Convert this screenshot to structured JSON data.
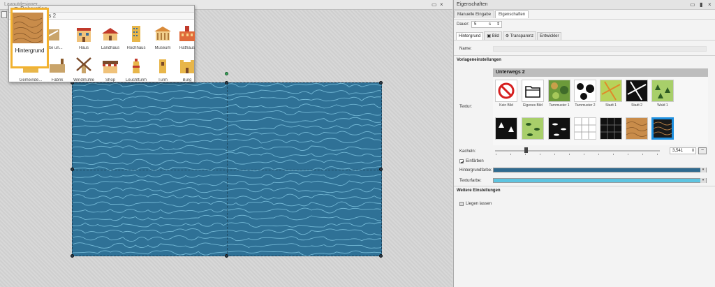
{
  "canvas": {
    "window_title": "Layoutdesigner",
    "colors": {
      "image_bg": "#2f7196",
      "line": "#7fc4e0"
    }
  },
  "palette": {
    "section": "Dekoration",
    "subsection": "Unterwegs 2",
    "selected_label": "Hintergrund",
    "row1": [
      "Hintergrund",
      "Straße un...",
      "Haus",
      "Landhaus",
      "Hochhaus",
      "Museum",
      "Rathaus"
    ],
    "row2": [
      "Gemeinde...",
      "Fabrik",
      "Windmühle",
      "Shop",
      "Leuchtturm",
      "Turm",
      "Burg"
    ]
  },
  "panel": {
    "title": "Eigenschaften",
    "tabs": [
      "Manuelle Eingabe",
      "Eigenschaften"
    ],
    "dauer_label": "Dauer:",
    "dauer_value": "5",
    "dauer_unit": "s",
    "subtabs": [
      "Hintergrund",
      "Bild",
      "Transparenz",
      "Entwickler"
    ],
    "name_label": "Name:",
    "vorlagen_head": "Vorlageneinstellungen",
    "textur_label": "Textur:",
    "texture_group": "Unterwegs 2",
    "textures_row1": [
      {
        "label": "Kein Bild",
        "icon": "no-image-icon"
      },
      {
        "label": "Eigenes Bild",
        "icon": "folder-icon"
      },
      {
        "label": "Tarnmuster 1",
        "icon": "camo-green"
      },
      {
        "label": "Tarnmuster 2",
        "icon": "camo-bw"
      },
      {
        "label": "Stadt 1",
        "icon": "city-map-1"
      },
      {
        "label": "Stadt 2",
        "icon": "city-map-2"
      },
      {
        "label": "Wald 1",
        "icon": "forest-1"
      }
    ],
    "kacheln_label": "Kacheln:",
    "kacheln_value": "3,541",
    "einfaerben_label": "Einfärben",
    "hg_color_label": "Hintergrundfarbe:",
    "hg_color": "#2f6a8f",
    "tex_color_label": "Texturfarbe:",
    "tex_color": "#5ec4e0",
    "weitere_head": "Weitere Einstellungen",
    "liegen_label": "Liegen lassen"
  }
}
